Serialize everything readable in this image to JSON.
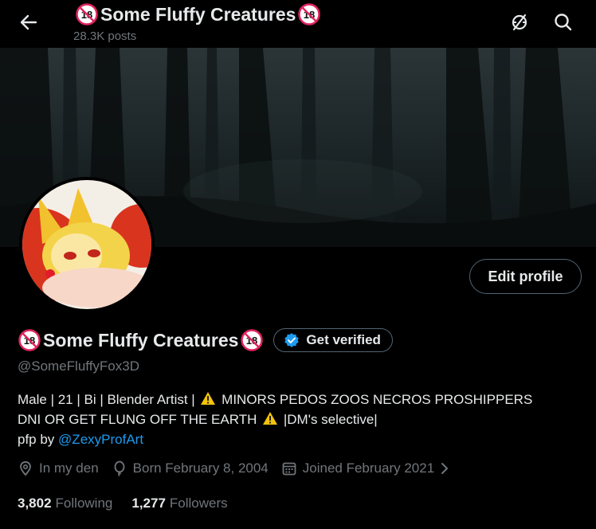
{
  "header": {
    "title": "Some Fluffy Creatures",
    "badge_text": "18",
    "post_count": "28.3K posts"
  },
  "icons": {
    "back": "arrow-left-icon",
    "analytics": "analytics-icon",
    "search": "search-icon",
    "location": "location-pin-icon",
    "birthday": "balloon-icon",
    "calendar": "calendar-icon",
    "verified": "verified-badge-icon",
    "warning": "warning-emoji"
  },
  "profile": {
    "edit_label": "Edit profile",
    "display_name": "Some Fluffy Creatures",
    "get_verified_label": "Get verified",
    "handle": "@SomeFluffyFox3D",
    "bio": {
      "line1_a": "Male | 21 | Bi | Blender Artist |",
      "line1_b": "MINORS PEDOS ZOOS NECROS PROSHIPPERS",
      "line2_a": "DNI OR GET FLUNG OFF THE EARTH",
      "line2_b": "|DM's selective|",
      "line3_a": "pfp by",
      "line3_link": "@ZexyProfArt"
    },
    "location": "In my den",
    "born": "Born February 8, 2004",
    "joined": "Joined February 2021",
    "following_count": "3,802",
    "following_label": "Following",
    "followers_count": "1,277",
    "followers_label": "Followers"
  },
  "colors": {
    "background": "#000000",
    "text": "#e7e9ea",
    "muted": "#71767b",
    "link": "#1d9bf0",
    "border": "#536471",
    "badge_red": "#e0245e"
  }
}
